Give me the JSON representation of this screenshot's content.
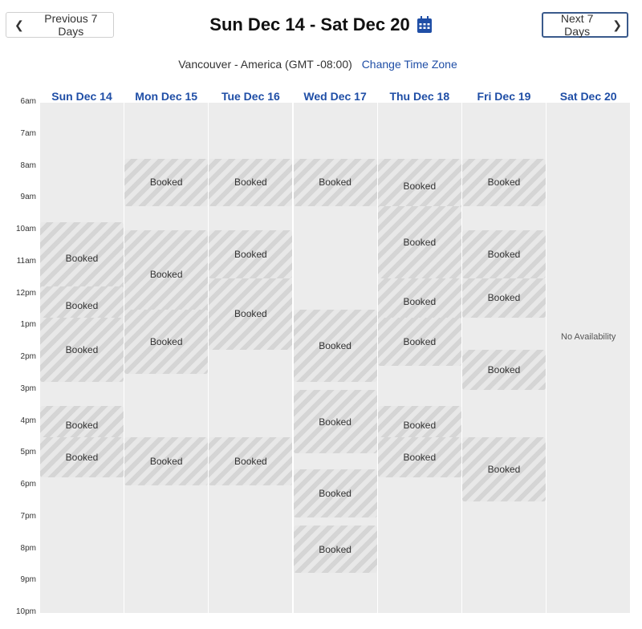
{
  "nav": {
    "prev_label": "Previous 7 Days",
    "next_label": "Next 7 Days"
  },
  "title": "Sun Dec 14 - Sat Dec 20",
  "timezone": {
    "label": "Vancouver - America (GMT -08:00)",
    "change_link": "Change Time Zone"
  },
  "hours": [
    "6am",
    "7am",
    "8am",
    "9am",
    "10am",
    "11am",
    "12pm",
    "1pm",
    "2pm",
    "3pm",
    "4pm",
    "5pm",
    "6pm",
    "7pm",
    "8pm",
    "9pm",
    "10pm"
  ],
  "colors": {
    "accent": "#1f4ea6",
    "booked_bg": "#dcdcdc",
    "column_bg": "#ececec"
  },
  "icons": {
    "calendar": "calendar-icon",
    "prev": "chevron-left-icon",
    "next": "chevron-right-icon"
  },
  "booked_label": "Booked",
  "days": [
    {
      "label": "Sun Dec 14",
      "blocks": [
        {
          "start": 9.75,
          "end": 12.0,
          "label": "Booked"
        },
        {
          "start": 11.75,
          "end": 13.0,
          "label": "Booked"
        },
        {
          "start": 12.75,
          "end": 14.75,
          "label": "Booked"
        },
        {
          "start": 15.5,
          "end": 16.75,
          "label": "Booked"
        },
        {
          "start": 16.5,
          "end": 17.75,
          "label": "Booked"
        }
      ]
    },
    {
      "label": "Mon Dec 15",
      "blocks": [
        {
          "start": 7.75,
          "end": 9.25,
          "label": "Booked"
        },
        {
          "start": 10.0,
          "end": 12.75,
          "label": "Booked"
        },
        {
          "start": 12.5,
          "end": 14.5,
          "label": "Booked"
        },
        {
          "start": 16.5,
          "end": 18.0,
          "label": "Booked"
        }
      ]
    },
    {
      "label": "Tue Dec 16",
      "blocks": [
        {
          "start": 7.75,
          "end": 9.25,
          "label": "Booked"
        },
        {
          "start": 10.0,
          "end": 11.5,
          "label": "Booked"
        },
        {
          "start": 11.5,
          "end": 13.75,
          "label": "Booked"
        },
        {
          "start": 16.5,
          "end": 18.0,
          "label": "Booked"
        }
      ]
    },
    {
      "label": "Wed Dec 17",
      "blocks": [
        {
          "start": 7.75,
          "end": 9.25,
          "label": "Booked"
        },
        {
          "start": 12.5,
          "end": 14.75,
          "label": "Booked"
        },
        {
          "start": 15.0,
          "end": 17.0,
          "label": "Booked"
        },
        {
          "start": 17.5,
          "end": 19.0,
          "label": "Booked"
        },
        {
          "start": 19.25,
          "end": 20.75,
          "label": "Booked"
        }
      ]
    },
    {
      "label": "Thu Dec 18",
      "blocks": [
        {
          "start": 7.75,
          "end": 9.5,
          "label": "Booked"
        },
        {
          "start": 9.25,
          "end": 11.5,
          "label": "Booked"
        },
        {
          "start": 11.5,
          "end": 13.0,
          "label": "Booked"
        },
        {
          "start": 12.75,
          "end": 14.25,
          "label": "Booked"
        },
        {
          "start": 15.5,
          "end": 16.75,
          "label": "Booked"
        },
        {
          "start": 16.5,
          "end": 17.75,
          "label": "Booked"
        }
      ]
    },
    {
      "label": "Fri Dec 19",
      "blocks": [
        {
          "start": 7.75,
          "end": 9.25,
          "label": "Booked"
        },
        {
          "start": 10.0,
          "end": 11.5,
          "label": "Booked"
        },
        {
          "start": 11.5,
          "end": 12.75,
          "label": "Booked"
        },
        {
          "start": 13.75,
          "end": 15.0,
          "label": "Booked"
        },
        {
          "start": 16.5,
          "end": 18.5,
          "label": "Booked"
        }
      ]
    },
    {
      "label": "Sat Dec 20",
      "blocks": [],
      "no_availability": "No Availability"
    }
  ]
}
